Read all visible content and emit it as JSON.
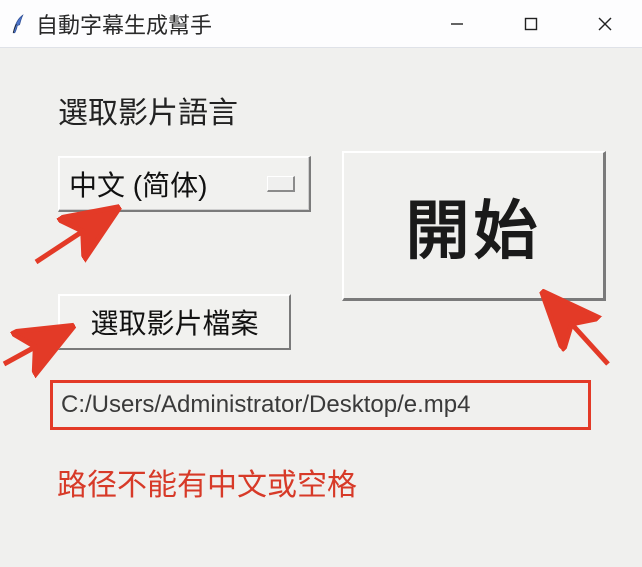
{
  "window": {
    "title": "自動字幕生成幫手"
  },
  "main": {
    "language_section_label": "選取影片語言",
    "language_selected": "中文 (简体)",
    "pick_file_label": "選取影片檔案",
    "start_label": "開始",
    "file_path": "C:/Users/Administrator/Desktop/e.mp4",
    "path_warning": "路径不能有中文或空格"
  }
}
